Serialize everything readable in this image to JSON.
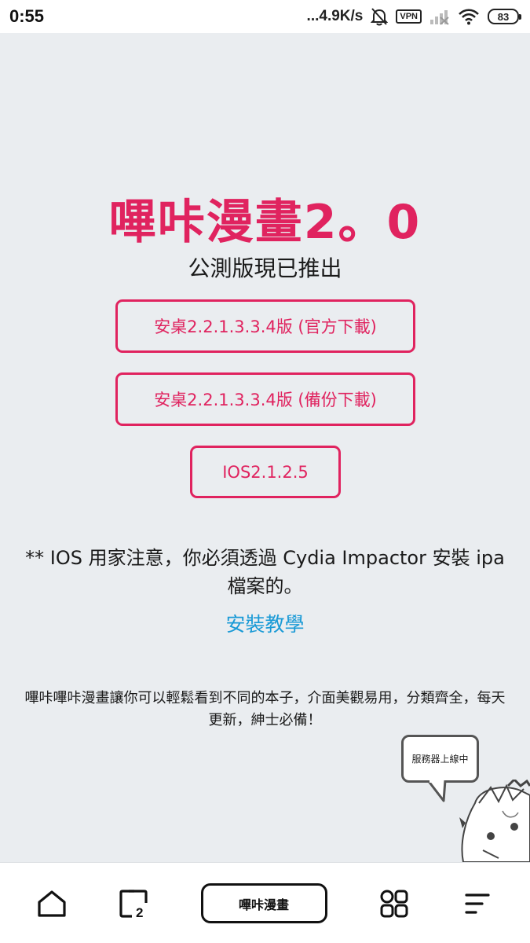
{
  "status_bar": {
    "time": "0:55",
    "net_speed": "...4.9K/s",
    "vpn": "VPN",
    "battery": "83"
  },
  "main": {
    "title": "嗶咔漫畫2。0",
    "subtitle": "公測版現已推出",
    "buttons": {
      "official": "安桌2.2.1.3.3.4版 (官方下載)",
      "backup": "安桌2.2.1.3.3.4版 (備份下載)",
      "ios": "IOS2.1.2.5"
    },
    "ios_note": "** IOS 用家注意，你必須透過 Cydia Impactor 安裝 ipa 檔案的。",
    "tutorial_link": "安裝教學",
    "description": "嗶咔嗶咔漫畫讓你可以輕鬆看到不同的本子，介面美觀易用，分類齊全，每天更新，紳士必備！",
    "bubble_text": "服務器上線中"
  },
  "bottom_nav": {
    "home_icon": "home-icon",
    "badge_icon": "square-two-icon",
    "center_label": "嗶咔漫畫",
    "grid_icon": "grid-icon",
    "menu_icon": "menu-icon"
  },
  "colors": {
    "accent": "#e0235f",
    "link": "#1a9ad6",
    "background": "#eaedf0"
  }
}
